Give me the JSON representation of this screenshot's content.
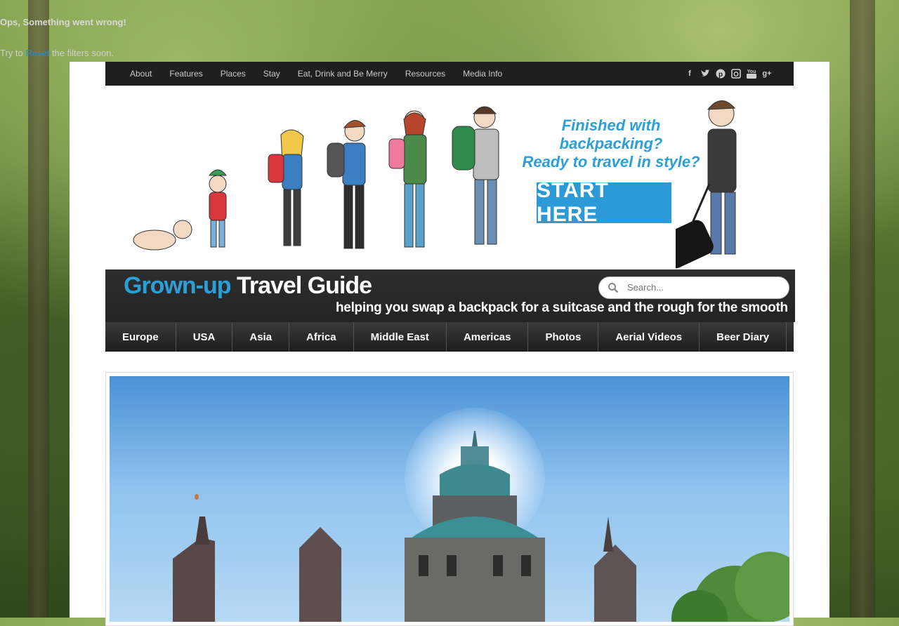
{
  "error": {
    "title": "Ops, Something went wrong!",
    "prefix": "Try to ",
    "link": "Reset",
    "suffix": " the filters soon."
  },
  "topnav": {
    "links": [
      "About",
      "Features",
      "Places",
      "Stay",
      "Eat, Drink and Be Merry",
      "Resources",
      "Media Info"
    ],
    "social": [
      "facebook-icon",
      "twitter-icon",
      "pinterest-icon",
      "instagram-icon",
      "youtube-icon",
      "google-plus-icon"
    ]
  },
  "banner": {
    "headline_line1": "Finished with backpacking?",
    "headline_line2": "Ready to travel in style?",
    "cta": "START HERE"
  },
  "logo": {
    "part1": "Grown-up",
    "part2": "Travel Guide",
    "tagline": "helping you swap a backpack for a suitcase and the rough for the smooth"
  },
  "search": {
    "placeholder": "Search..."
  },
  "mainnav": [
    "Europe",
    "USA",
    "Asia",
    "Africa",
    "Middle East",
    "Americas",
    "Photos",
    "Aerial Videos",
    "Beer Diary"
  ],
  "colors": {
    "accent": "#2a9fd8",
    "nav_bg": "#1f1f1f"
  }
}
